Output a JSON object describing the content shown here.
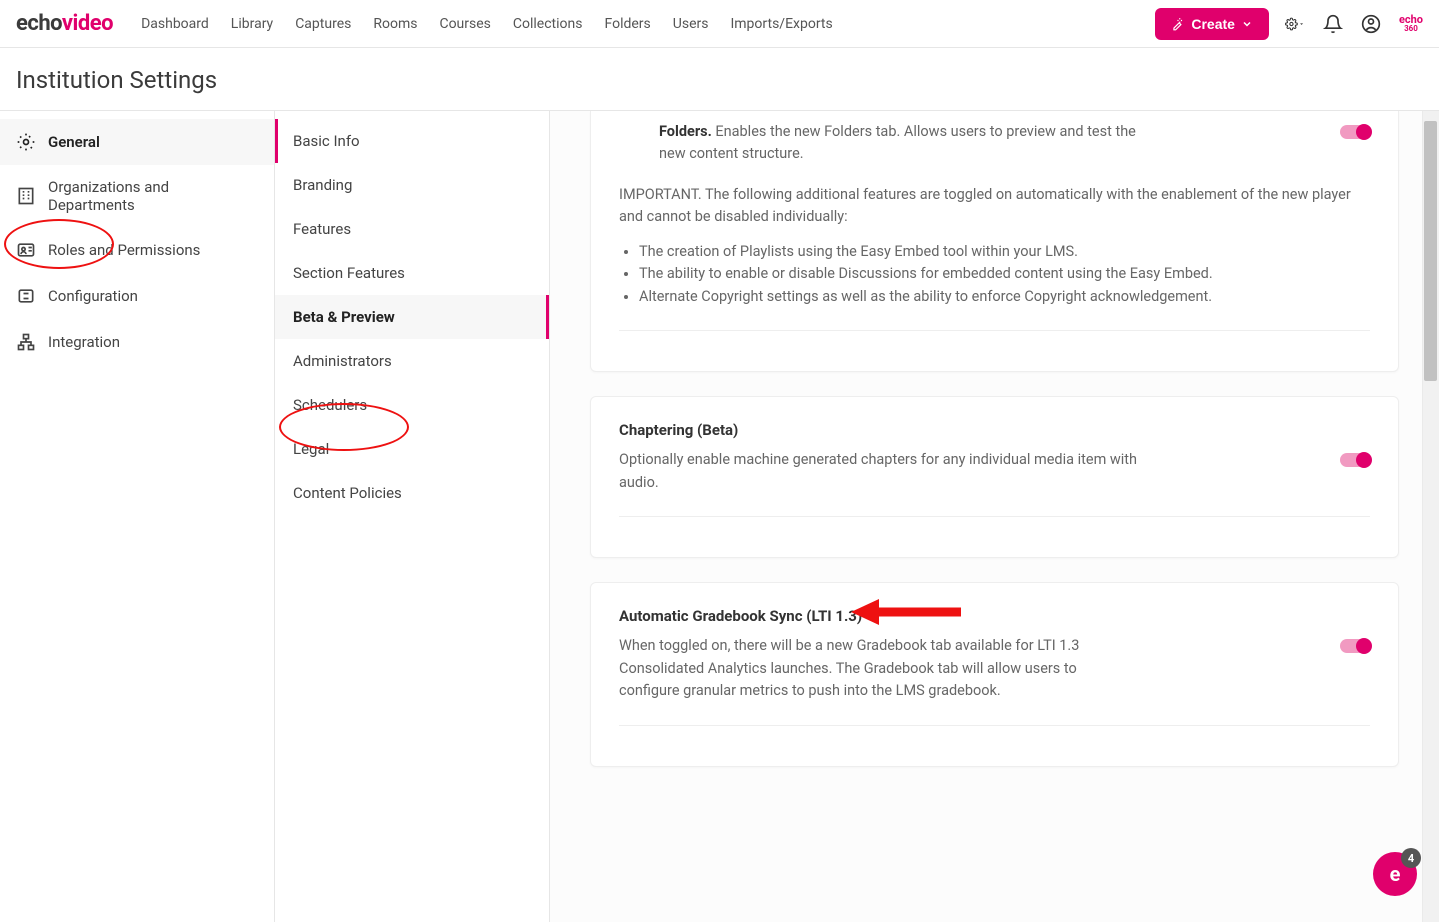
{
  "logo": {
    "part1": "echo",
    "part2": "video",
    "mini": "echo",
    "mini2": "360"
  },
  "nav": [
    "Dashboard",
    "Library",
    "Captures",
    "Rooms",
    "Courses",
    "Collections",
    "Folders",
    "Users",
    "Imports/Exports"
  ],
  "create_label": "Create",
  "page_title": "Institution Settings",
  "sidebar1": [
    {
      "label": "General",
      "active": true
    },
    {
      "label": "Organizations and Departments",
      "active": false
    },
    {
      "label": "Roles and Permissions",
      "active": false
    },
    {
      "label": "Configuration",
      "active": false
    },
    {
      "label": "Integration",
      "active": false
    }
  ],
  "sidebar2": [
    {
      "label": "Basic Info"
    },
    {
      "label": "Branding"
    },
    {
      "label": "Features"
    },
    {
      "label": "Section Features"
    },
    {
      "label": "Beta & Preview",
      "active": true
    },
    {
      "label": "Administrators"
    },
    {
      "label": "Schedulers"
    },
    {
      "label": "Legal"
    },
    {
      "label": "Content Policies"
    }
  ],
  "card_folders": {
    "title": "Folders.",
    "text": " Enables the new Folders tab. Allows users to preview and test the new content structure.",
    "important_lead": "IMPORTANT. The following additional features are toggled on automatically with the enablement of the new player and cannot be disabled individually:",
    "bullets": [
      "The creation of Playlists using the Easy Embed tool within your LMS.",
      "The ability to enable or disable Discussions for embedded content using the Easy Embed.",
      "Alternate Copyright settings as well as the ability to enforce Copyright acknowledgement."
    ]
  },
  "card_chaptering": {
    "title": "Chaptering (Beta)",
    "text": "Optionally enable machine generated chapters for any individual media item with audio."
  },
  "card_gradebook": {
    "title": "Automatic Gradebook Sync (LTI 1.3)",
    "text": "When toggled on, there will be a new Gradebook tab available for LTI 1.3 Consolidated Analytics launches. The Gradebook tab will allow users to configure granular metrics to push into the LMS gradebook."
  },
  "chat_badge": "4",
  "chat_letter": "e"
}
